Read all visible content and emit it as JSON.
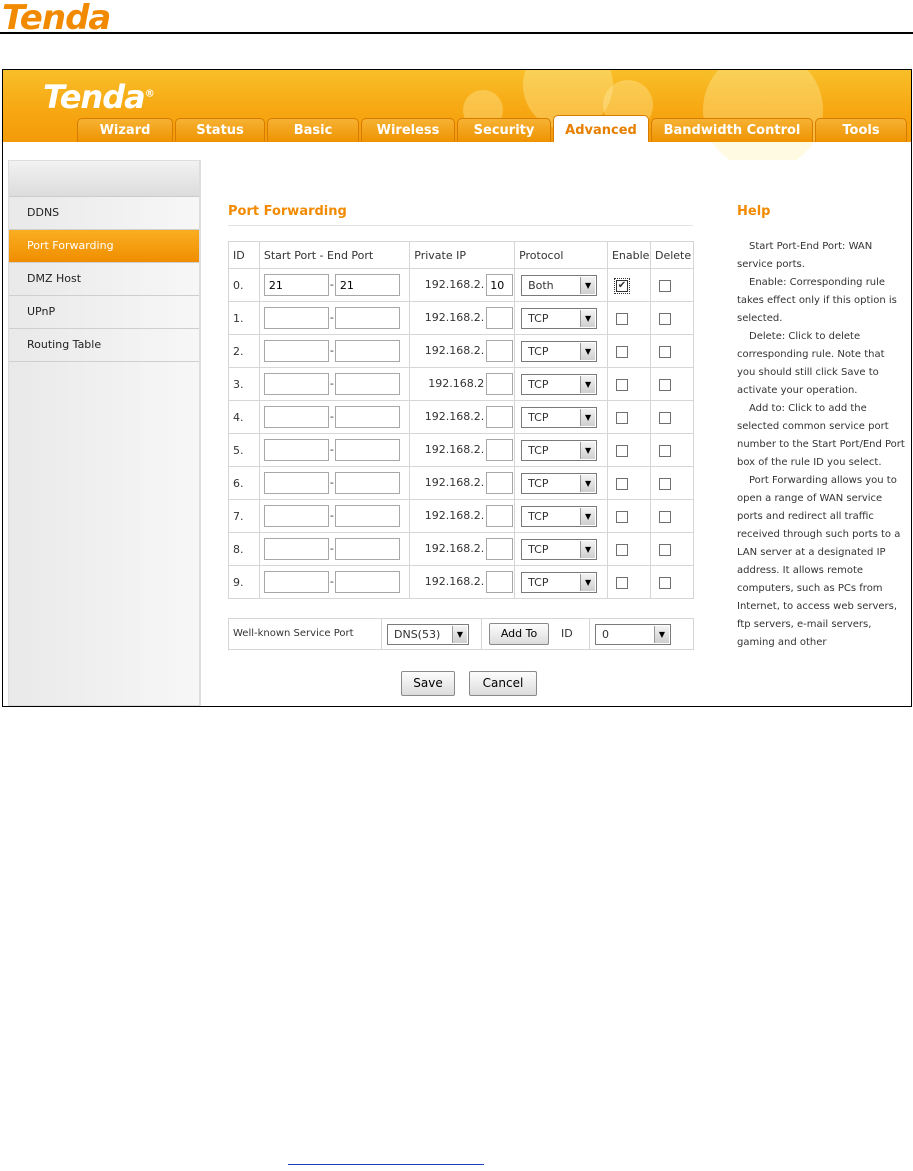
{
  "document": {
    "logo": "Tenda"
  },
  "app": {
    "logo": "Tenda"
  },
  "tabs": [
    "Wizard",
    "Status",
    "Basic",
    "Wireless",
    "Security",
    "Advanced",
    "Bandwidth Control",
    "Tools"
  ],
  "active_tab": "Advanced",
  "sidebar": {
    "items": [
      "DDNS",
      "Port Forwarding",
      "DMZ Host",
      "UPnP",
      "Routing Table"
    ],
    "active": "Port Forwarding"
  },
  "main": {
    "title": "Port Forwarding",
    "columns": [
      "ID",
      "Start Port - End Port",
      "Private IP",
      "Protocol",
      "Enable",
      "Delete"
    ],
    "ip_prefix": "192.168.2.",
    "ip_prefix_short": "192.168.2",
    "rows": [
      {
        "id": "0.",
        "start": "21",
        "end": "21",
        "ip": "10",
        "protocol": "Both",
        "enabled": true
      },
      {
        "id": "1.",
        "start": "",
        "end": "",
        "ip": "",
        "protocol": "TCP",
        "enabled": false
      },
      {
        "id": "2.",
        "start": "",
        "end": "",
        "ip": "",
        "protocol": "TCP",
        "enabled": false
      },
      {
        "id": "3.",
        "start": "",
        "end": "",
        "ip": "",
        "protocol": "TCP",
        "enabled": false
      },
      {
        "id": "4.",
        "start": "",
        "end": "",
        "ip": "",
        "protocol": "TCP",
        "enabled": false
      },
      {
        "id": "5.",
        "start": "",
        "end": "",
        "ip": "",
        "protocol": "TCP",
        "enabled": false
      },
      {
        "id": "6.",
        "start": "",
        "end": "",
        "ip": "",
        "protocol": "TCP",
        "enabled": false
      },
      {
        "id": "7.",
        "start": "",
        "end": "",
        "ip": "",
        "protocol": "TCP",
        "enabled": false
      },
      {
        "id": "8.",
        "start": "",
        "end": "",
        "ip": "",
        "protocol": "TCP",
        "enabled": false
      },
      {
        "id": "9.",
        "start": "",
        "end": "",
        "ip": "",
        "protocol": "TCP",
        "enabled": false
      }
    ],
    "well_known": {
      "label": "Well-known Service Port",
      "service": "DNS(53)",
      "add_to_label": "Add To",
      "id_label": "ID",
      "id_value": "0"
    },
    "save_label": "Save",
    "cancel_label": "Cancel"
  },
  "help": {
    "title": "Help",
    "paragraphs": [
      "Start Port-End Port: WAN service ports.",
      "Enable: Corresponding rule takes effect only if this option is selected.",
      "Delete: Click to delete corresponding rule. Note that you should still click Save to activate your operation.",
      "Add to: Click to add the selected common service port number to the Start Port/End Port box of the rule ID you select.",
      "Port Forwarding allows you to open a range of WAN service ports and redirect all traffic received through such ports to a LAN server at a designated IP address. It allows remote computers, such as PCs from Internet, to access web servers, ftp servers, e-mail servers, gaming and other"
    ]
  },
  "colors": {
    "accent": "#f28a00",
    "tab_bg": "#f39a08"
  }
}
